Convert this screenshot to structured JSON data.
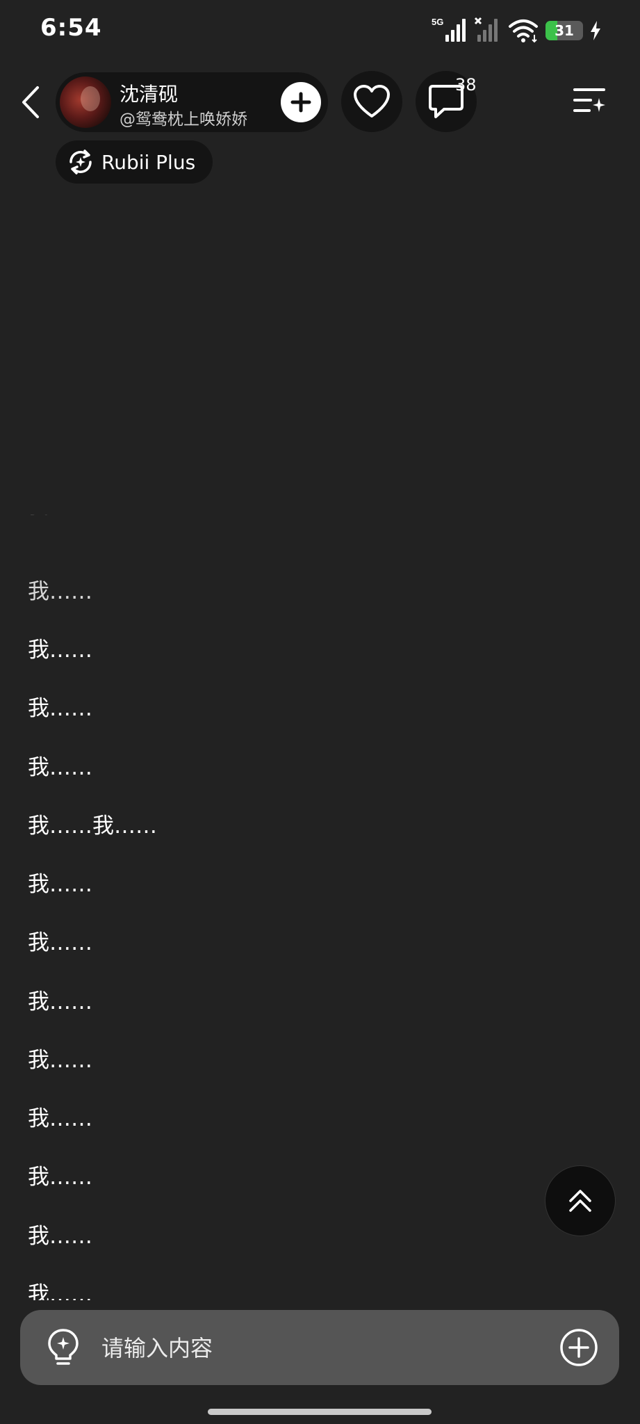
{
  "status_bar": {
    "time": "6:54",
    "network_label": "5G",
    "battery_level": "31",
    "battery_percent": 31
  },
  "header": {
    "character_name": "沈清砚",
    "character_handle": "@鸳鸯枕上唤娇娇",
    "comment_count": "38",
    "model_label": "Rubii Plus"
  },
  "messages": [
    "我……",
    "我……",
    "我……",
    "我……",
    "我……",
    "我……我……",
    "我……",
    "我……",
    "我……",
    "我……",
    "我……",
    "我……",
    "我……",
    "我……"
  ],
  "input": {
    "placeholder": "请输入内容",
    "value": ""
  },
  "icons": {
    "back": "chevron-left-icon",
    "follow": "plus-icon",
    "like": "heart-icon",
    "comment": "chat-bubble-icon",
    "menu": "menu-sparkle-icon",
    "model": "swap-sparkle-icon",
    "scroll_top": "double-chevron-up-icon",
    "idea": "lightbulb-icon",
    "attach": "plus-circle-icon"
  },
  "colors": {
    "background": "#222222",
    "pill": "#141414",
    "input_bar": "#555555",
    "battery_fill": "#3cc14a"
  }
}
